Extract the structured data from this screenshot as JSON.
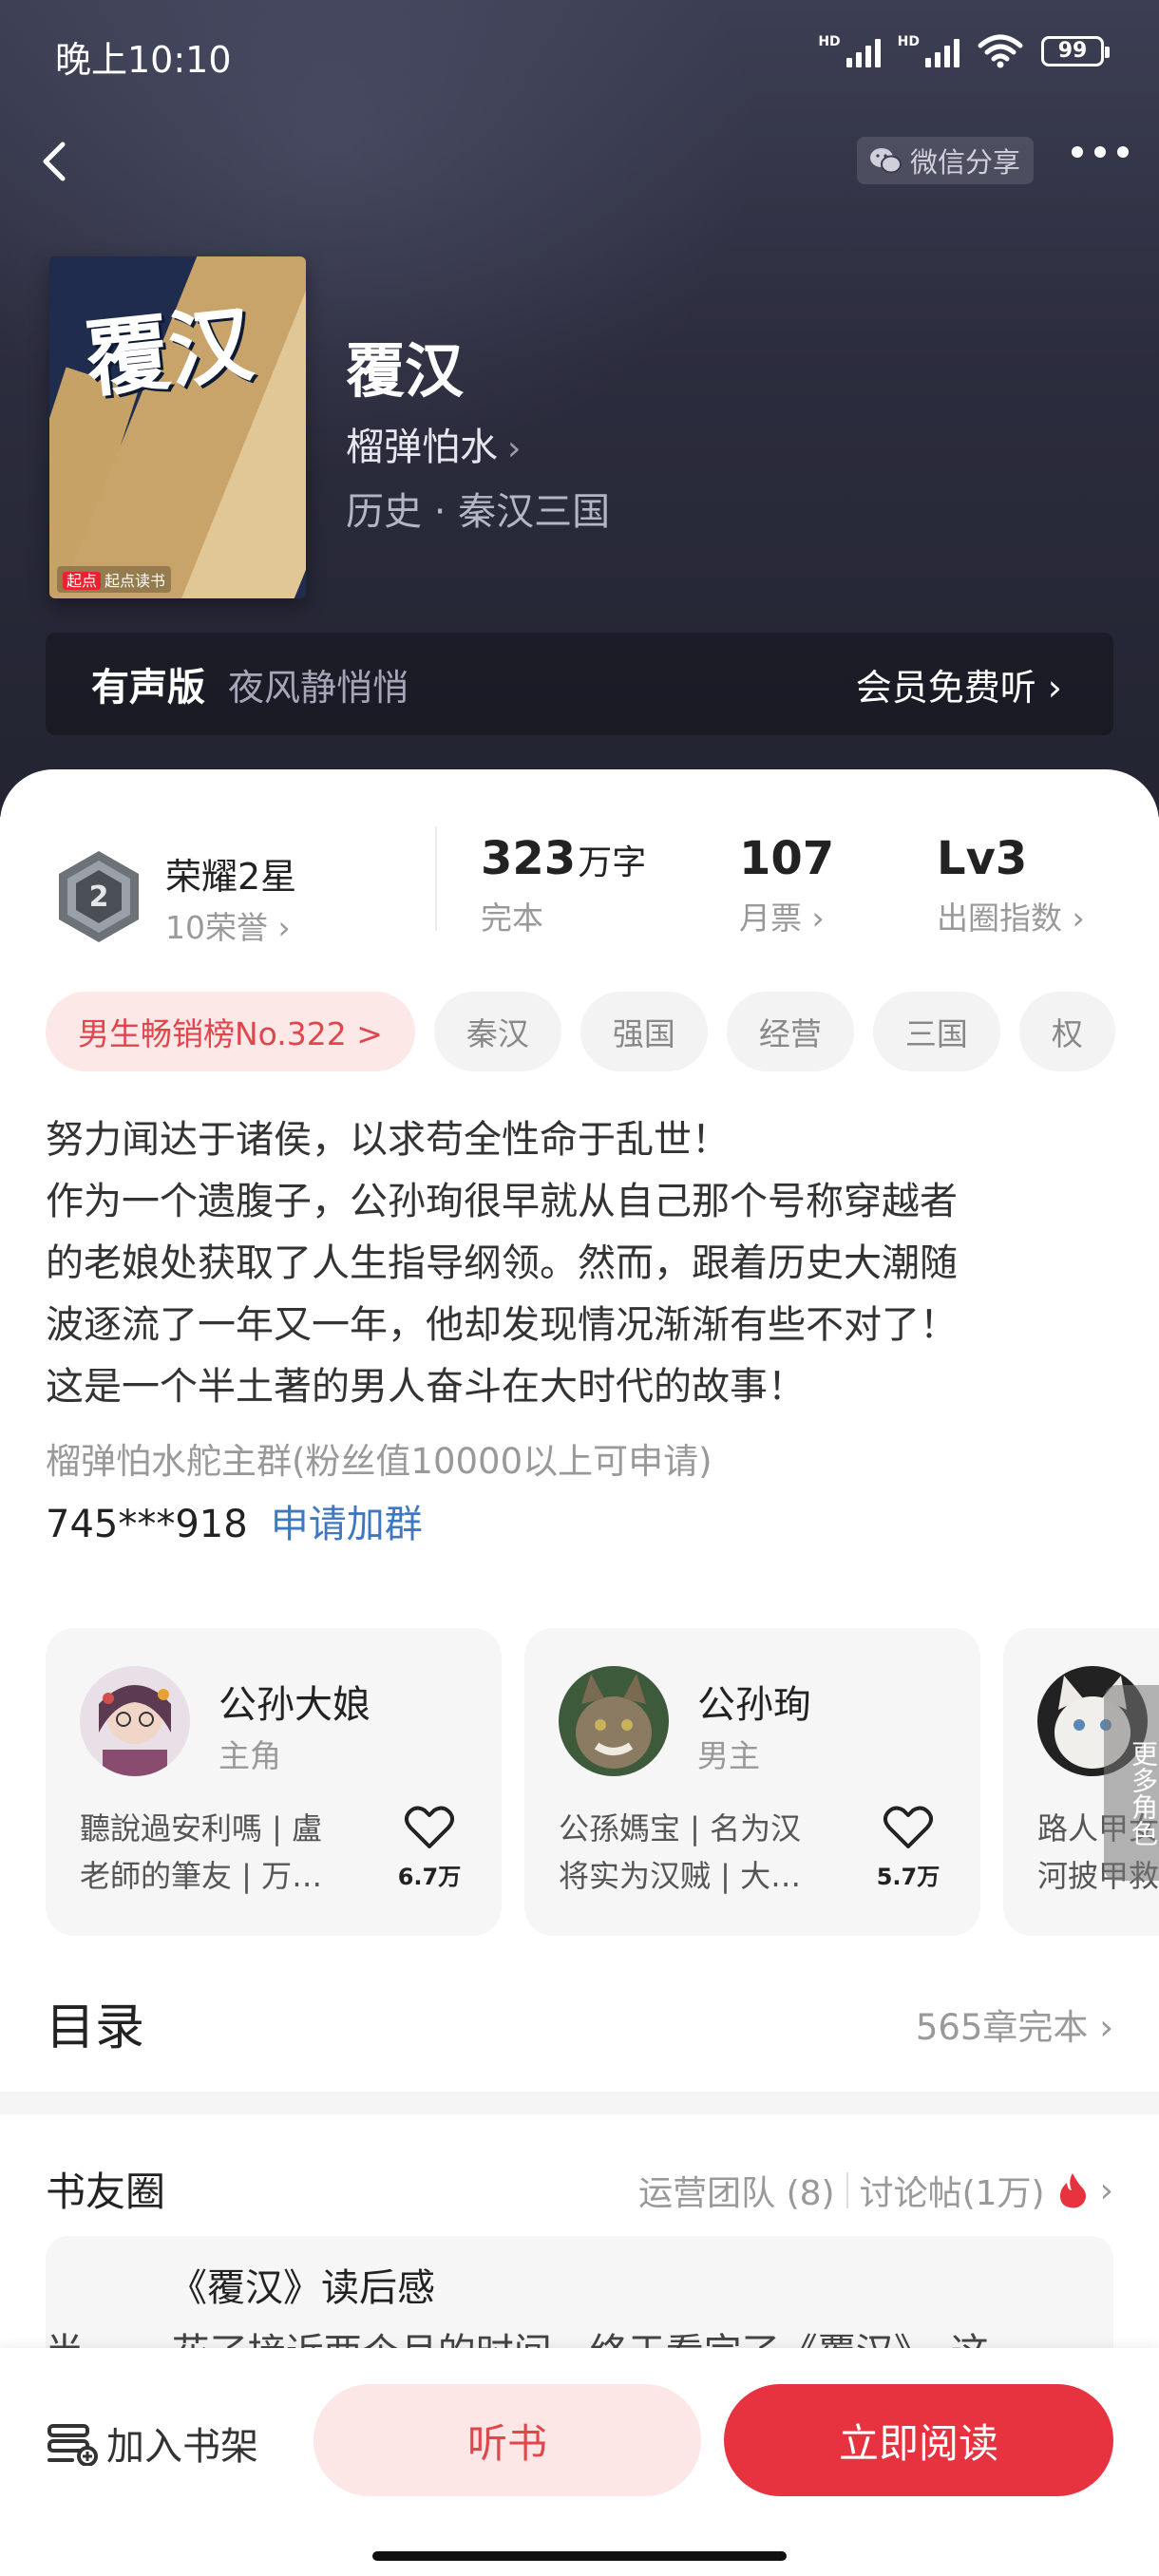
{
  "status_bar": {
    "time": "晚上10:10",
    "battery": "99",
    "signal_label": "HD"
  },
  "nav": {
    "share_label": "微信分享"
  },
  "book": {
    "cover_title": "覆汉",
    "cover_brand": "起点读书",
    "cover_brand_tag": "起点",
    "title": "覆汉",
    "author": "榴弹怕水",
    "genre": "历史 · 秦汉三国"
  },
  "audio": {
    "label": "有声版",
    "narrator": "夜风静悄悄",
    "action": "会员免费听"
  },
  "honor": {
    "name": "荣耀2星",
    "sub": "10荣誉",
    "medal_number": "2"
  },
  "stats": [
    {
      "value": "323",
      "unit": "万字",
      "label": "完本"
    },
    {
      "value": "107",
      "unit": "",
      "label": "月票"
    },
    {
      "value": "Lv3",
      "unit": "",
      "label": "出圈指数"
    }
  ],
  "tags": [
    "男生畅销榜No.322 >",
    "秦汉",
    "强国",
    "经营",
    "三国",
    "权"
  ],
  "description": [
    "努力闻达于诸侯，以求苟全性命于乱世！",
    "作为一个遗腹子，公孙珣很早就从自己那个号称穿越者",
    "的老娘处获取了人生指导纲领。然而，跟着历史大潮随",
    "波逐流了一年又一年，他却发现情况渐渐有些不对了！",
    "这是一个半土著的男人奋斗在大时代的故事！"
  ],
  "fan_group": {
    "text": "榴弹怕水舵主群(粉丝值10000以上可申请)",
    "number": "745***918",
    "join_label": "申请加群"
  },
  "roles": [
    {
      "name": "公孙大娘",
      "type": "主角",
      "desc1": "聽說過安利嗎 | 盧",
      "desc2": "老師的筆友 | 万…",
      "likes": "6.7万"
    },
    {
      "name": "公孙珣",
      "type": "男主",
      "desc1": "公孫媽宝 | 名为汉",
      "desc2": "将实为汉贼 | 大…",
      "likes": "5.7万"
    },
    {
      "name": "",
      "type": "",
      "desc1": "路人甲女",
      "desc2": "河披甲救",
      "likes": ""
    }
  ],
  "more_roles_label": "更多角色",
  "toc": {
    "title": "目录",
    "summary": "565章完本"
  },
  "circle": {
    "title": "书友圈",
    "team": "运营团队 (8)",
    "posts": "讨论帖(1万)",
    "post_title": "《覆汉》读后感",
    "post_body": "半…… 花了接近两个月的时间，终于看完了《覆汉》，这"
  },
  "bottom": {
    "shelf": "加入书架",
    "listen": "听书",
    "read": "立即阅读"
  }
}
